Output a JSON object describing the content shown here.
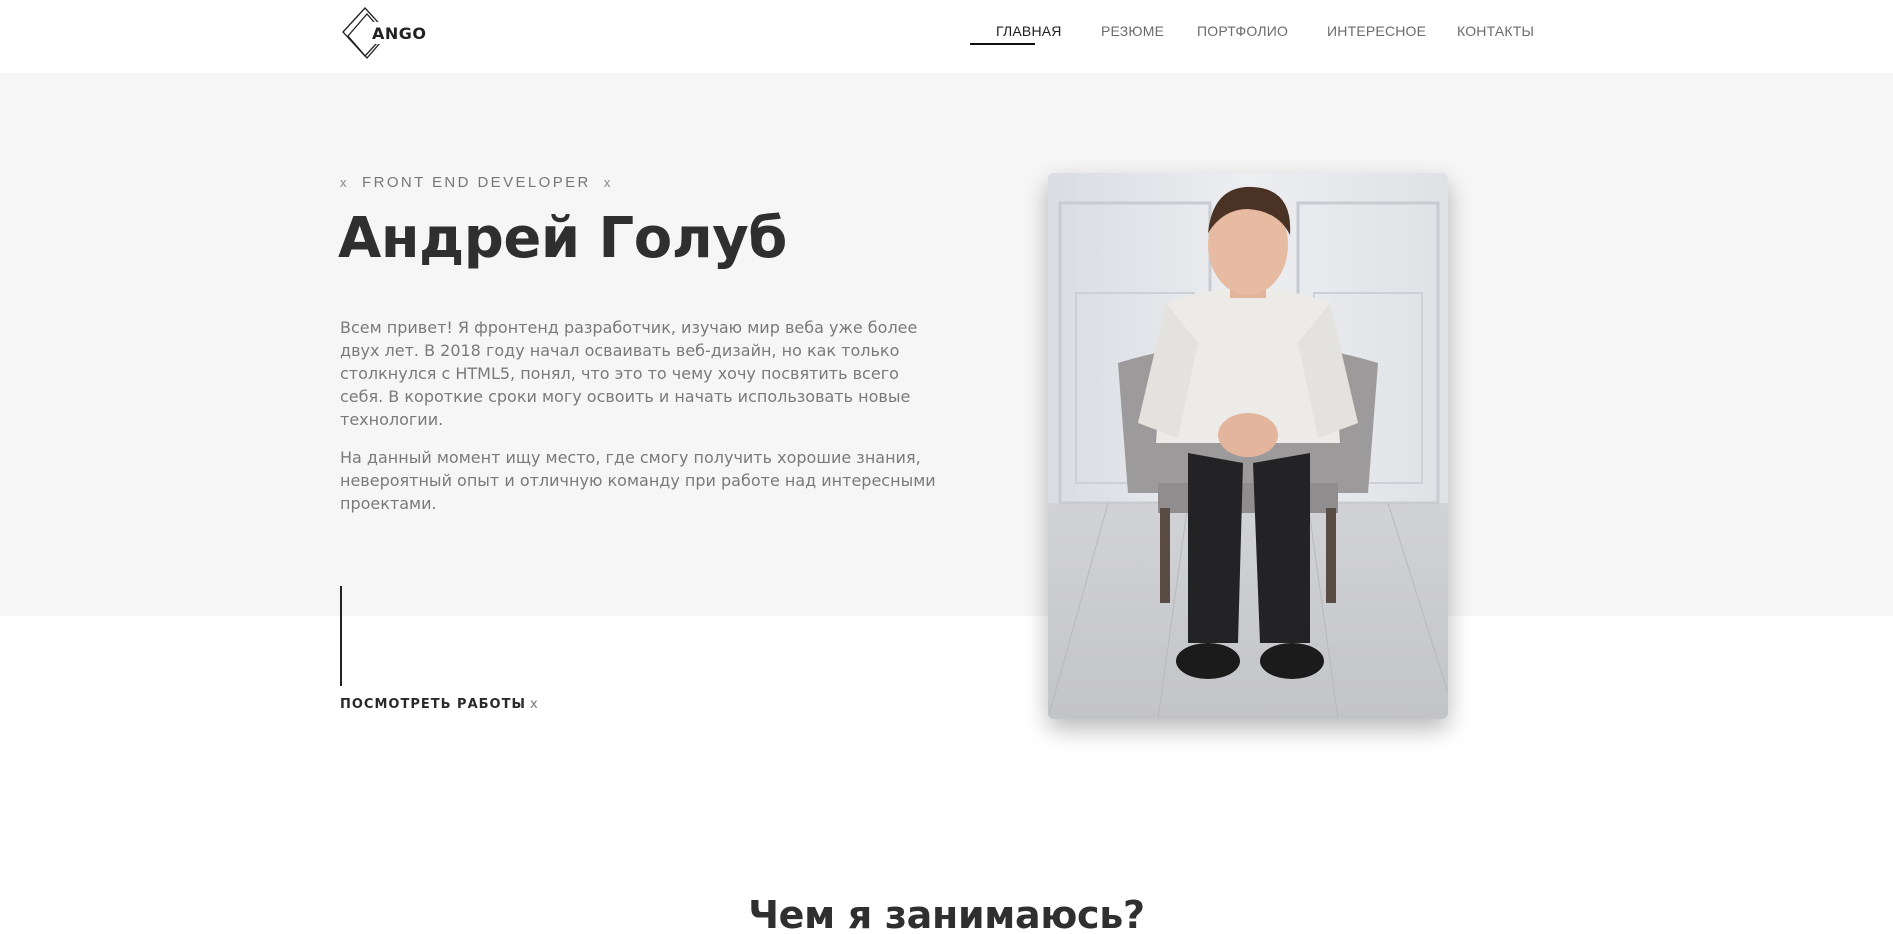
{
  "header": {
    "logo_text": "ANGO",
    "nav": [
      {
        "label": "ГЛАВНАЯ",
        "active": true
      },
      {
        "label": "РЕЗЮМЕ",
        "active": false
      },
      {
        "label": "ПОРТФОЛИО",
        "active": false
      },
      {
        "label": "ИНТЕРЕСНОЕ",
        "active": false
      },
      {
        "label": "КОНТАКТЫ",
        "active": false
      }
    ]
  },
  "hero": {
    "subtitle_marker": "x",
    "subtitle": "FRONT END DEVELOPER",
    "name": "Андрей Голуб",
    "paragraph_1": "Всем привет! Я фронтенд разработчик, изучаю мир веба уже более двух лет. В 2018 году начал осваивать веб-дизайн, но как только столкнулся с HTML5, понял, что это то чему хочу посвятить всего себя. В короткие сроки могу освоить и начать использовать новые технологии.",
    "paragraph_2": "На данный момент ищу место, где смогу получить хорошие знания, невероятный опыт и отличную команду при работе над интересными проектами.",
    "cta_label": "ПОСМОТРЕТЬ РАБОТЫ",
    "cta_marker": "x"
  },
  "sections": {
    "what_i_do_title": "Чем я занимаюсь?"
  },
  "colors": {
    "hero_background": "#f6f6f6",
    "text_dark": "#2f2f2f",
    "text_muted": "#7a7a7a",
    "accent_line": "#111111"
  },
  "icons": {
    "logo": "diamond-logo-icon",
    "portrait": "portrait-photo"
  }
}
